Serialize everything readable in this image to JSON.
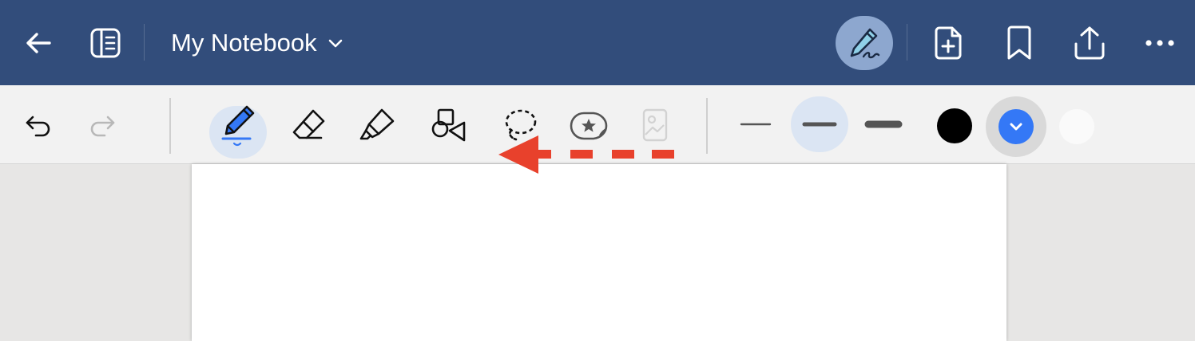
{
  "header": {
    "title": "My Notebook",
    "icons": [
      "back-arrow-icon",
      "notebook-pages-icon",
      "chevron-down-icon",
      "pen-handwriting-icon",
      "add-page-icon",
      "bookmark-icon",
      "share-icon",
      "more-icon"
    ]
  },
  "toolbar": {
    "tools": [
      "undo",
      "redo",
      "pen",
      "eraser",
      "highlighter",
      "shapes",
      "lasso",
      "sticker",
      "image"
    ],
    "active_tool": "pen",
    "stroke_widths": [
      "thin",
      "medium",
      "thick"
    ],
    "active_stroke_width": "medium",
    "colors": [
      "#000000",
      "#3478f6",
      "#ffffff"
    ],
    "active_color": "#3478f6"
  },
  "annotation": {
    "type": "dashed-arrow",
    "direction": "left",
    "color": "#e8412c"
  },
  "colors": {
    "header_bg": "#324d7b",
    "toolbar_bg": "#f2f2f2",
    "accent": "#3478f6",
    "active_highlight": "#dbe5f3"
  }
}
